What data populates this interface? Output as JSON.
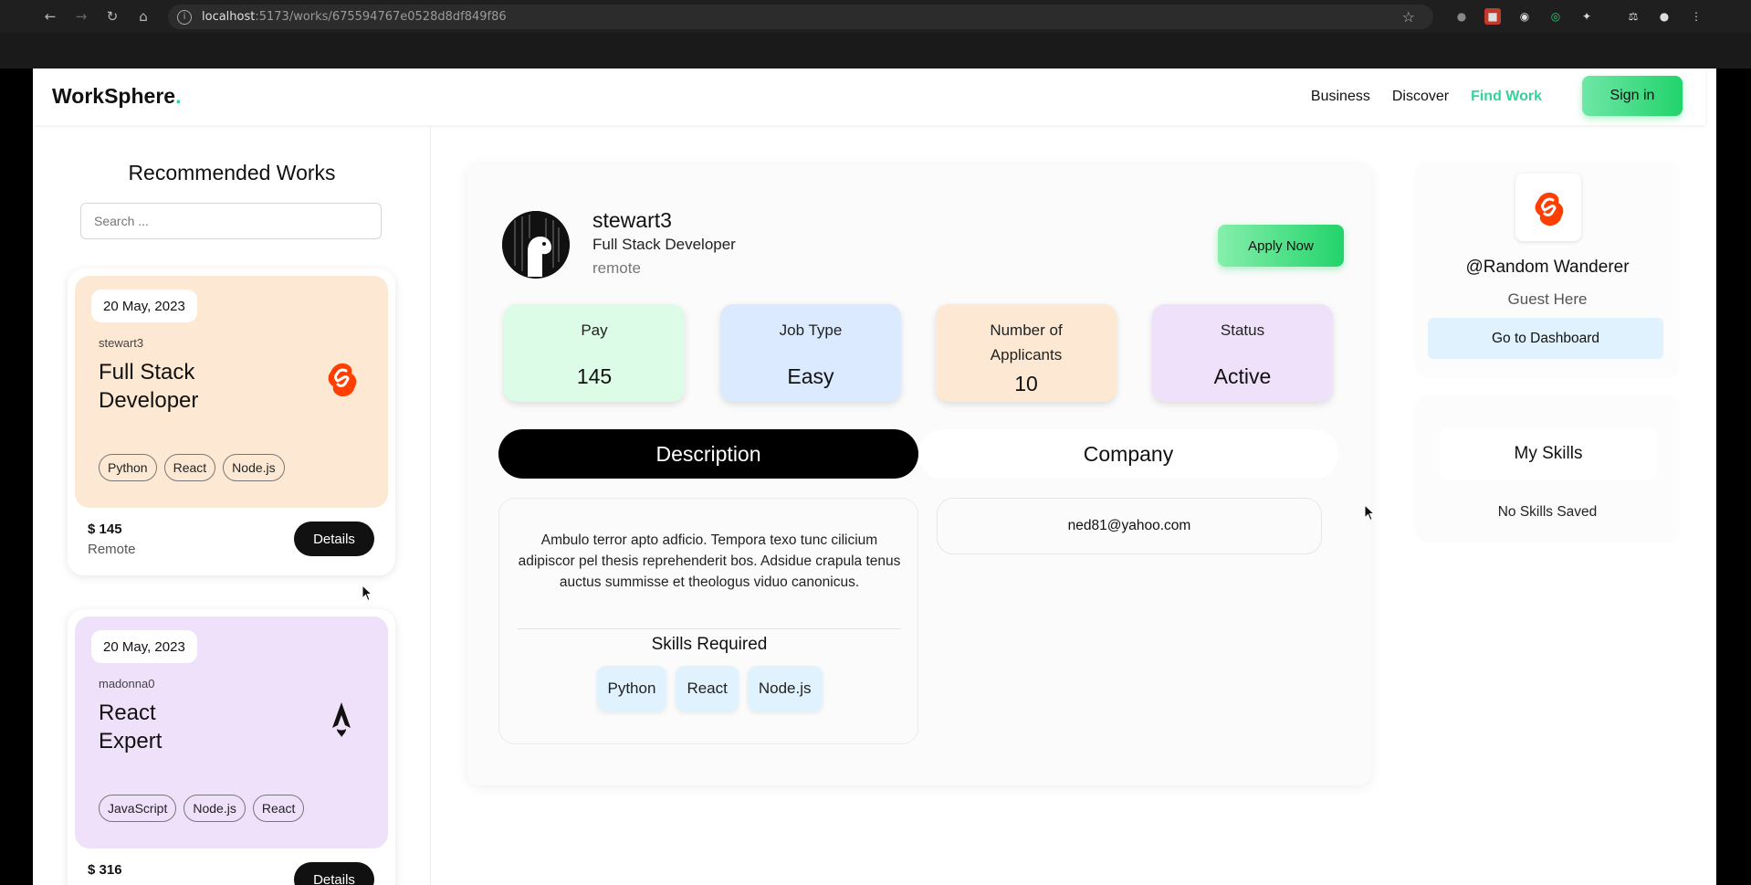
{
  "browser": {
    "url_host": "localhost",
    "url_path": ":5173/works/675594767e0528d8df849f86"
  },
  "header": {
    "logo": "WorkSphere",
    "logo_dot": ".",
    "nav": [
      "Business",
      "Discover",
      "Find Work"
    ],
    "active_nav": "Find Work",
    "sign_in": "Sign in"
  },
  "sidebar": {
    "title": "Recommended Works",
    "search_placeholder": "Search ...",
    "works": [
      {
        "date": "20 May, 2023",
        "user": "stewart3",
        "title": "Full Stack Developer",
        "logo_icon": "svelte-logo-icon",
        "tags": [
          "Python",
          "React",
          "Node.js"
        ],
        "pay": "$ 145",
        "location": "Remote",
        "details": "Details",
        "color": "#fde9d3"
      },
      {
        "date": "20 May, 2023",
        "user": "madonna0",
        "title": "React Expert",
        "logo_icon": "astro-logo-icon",
        "tags": [
          "JavaScript",
          "Node.js",
          "React"
        ],
        "pay": "$ 316",
        "location": "",
        "details": "Details",
        "color": "#f0e1fb"
      }
    ]
  },
  "job": {
    "name": "stewart3",
    "role": "Full Stack Developer",
    "location": "remote",
    "apply": "Apply Now",
    "stats": [
      {
        "label": "Pay",
        "value": "145",
        "color": "#dcfce7"
      },
      {
        "label": "Job Type",
        "value": "Easy",
        "color": "#dbeafe"
      },
      {
        "label": "Number of Applicants",
        "value": "10",
        "color": "#fde9d3"
      },
      {
        "label": "Status",
        "value": "Active",
        "color": "#f0e1fb"
      }
    ],
    "tabs": [
      "Description",
      "Company"
    ],
    "active_tab": "Description",
    "description": "Ambulo terror apto adficio. Tempora texo tunc cilicium adipiscor pel thesis reprehenderit bos. Adsidue crapula tenus auctus summisse et theologus viduo canonicus.",
    "skills_title": "Skills Required",
    "skills": [
      "Python",
      "React",
      "Node.js"
    ],
    "company_email": "ned81@yahoo.com"
  },
  "profile": {
    "handle": "@Random Wanderer",
    "subtitle": "Guest Here",
    "dashboard": "Go to Dashboard",
    "skills_title": "My Skills",
    "no_skills": "No Skills Saved"
  },
  "colors": {
    "accent": "#34d399",
    "svelte": "#ff3e00"
  }
}
